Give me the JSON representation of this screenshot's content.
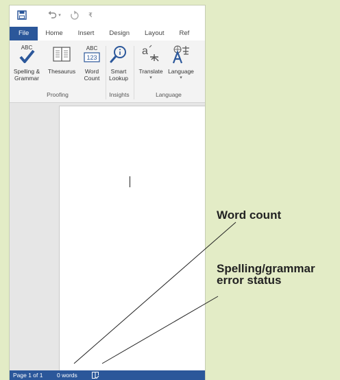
{
  "quick_access": {
    "save_icon": "save-icon",
    "undo_icon": "undo-icon",
    "undo_dropdown": "▾",
    "redo_icon": "redo-icon",
    "customize_glyph": "₹"
  },
  "tabs": [
    {
      "label": "File",
      "active": true
    },
    {
      "label": "Home"
    },
    {
      "label": "Insert"
    },
    {
      "label": "Design"
    },
    {
      "label": "Layout"
    },
    {
      "label": "Ref"
    }
  ],
  "ribbon": {
    "spelling": {
      "line1": "Spelling &",
      "line2": "Grammar",
      "icon_text": "ABC",
      "icon": "check-icon"
    },
    "thesaurus": {
      "line1": "Thesaurus",
      "icon": "book-icon"
    },
    "word_count": {
      "line1": "Word",
      "line2": "Count",
      "icon_top": "ABC",
      "icon_bottom": "123"
    },
    "smart_lookup": {
      "line1": "Smart",
      "line2": "Lookup",
      "icon": "search-icon"
    },
    "translate": {
      "line1": "Translate",
      "caret": "▾",
      "icon": "translate-icon"
    },
    "language": {
      "line1": "Language",
      "caret": "▾",
      "icon": "language-icon"
    },
    "groups": {
      "proofing": "Proofing",
      "insights": "Insights",
      "language": "Language"
    }
  },
  "statusbar": {
    "page": "Page 1 of 1",
    "words": "0 words",
    "proofing_icon": "proofing-status-icon"
  },
  "callouts": {
    "word_count": "Word count",
    "spelling_status": "Spelling/grammar error status"
  },
  "colors": {
    "background": "#e3ecc6",
    "accent": "#2b579a",
    "check": "#2b579a"
  }
}
